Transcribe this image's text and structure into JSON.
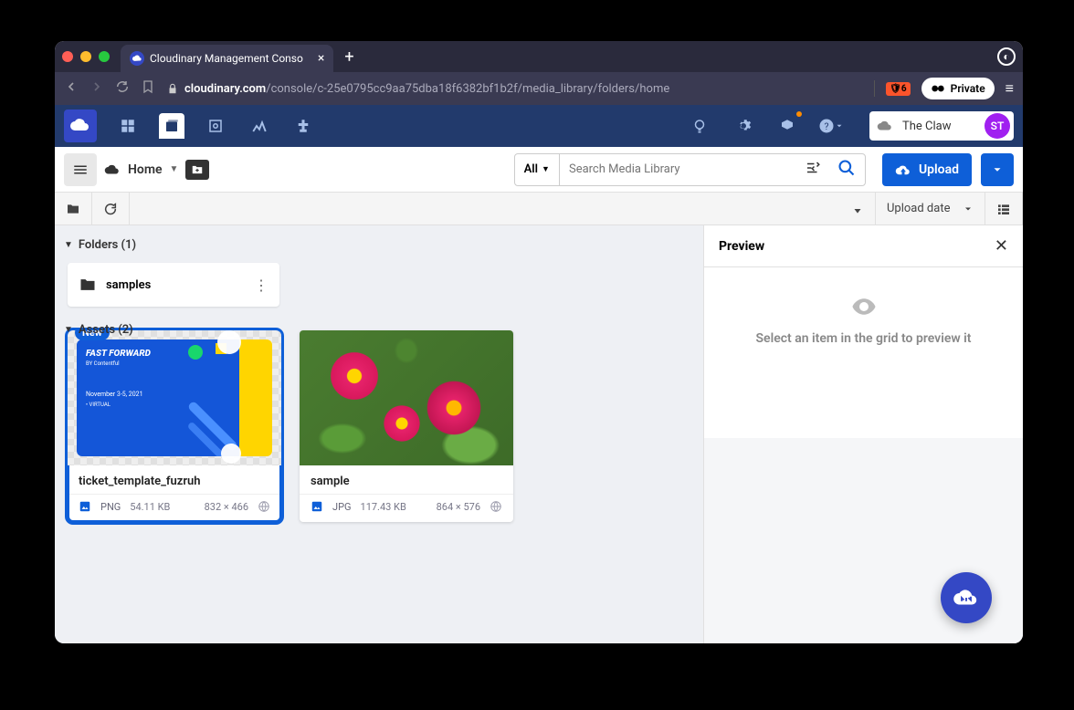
{
  "browser": {
    "tab_title": "Cloudinary Management Conso",
    "url_domain": "cloudinary.com",
    "url_path": "/console/c-25e0795cc9aa75dba18f6382bf1b2f/media_library/folders/home",
    "shield_count": "6",
    "private_label": "Private"
  },
  "account": {
    "name": "The Claw",
    "avatar_initials": "ST"
  },
  "toolbar": {
    "breadcrumb": "Home",
    "filter": "All",
    "search_placeholder": "Search Media Library",
    "upload_label": "Upload"
  },
  "subbar": {
    "sort_label": "Upload date"
  },
  "folders": {
    "header": "Folders (1)",
    "items": [
      {
        "name": "samples"
      }
    ]
  },
  "assets": {
    "header": "Assets (2)",
    "items": [
      {
        "badge": "New",
        "name": "ticket_template_fuzruh",
        "format": "PNG",
        "size": "54.11 KB",
        "dims": "832 × 466",
        "ticket_text": {
          "title": "FAST FORWARD",
          "subtitle": "BY Contentful",
          "date": "November 3-5, 2021",
          "virtual": "• VIRTUAL"
        }
      },
      {
        "name": "sample",
        "format": "JPG",
        "size": "117.43 KB",
        "dims": "864 × 576"
      }
    ]
  },
  "preview": {
    "title": "Preview",
    "empty_msg": "Select an item in the grid to preview it"
  }
}
